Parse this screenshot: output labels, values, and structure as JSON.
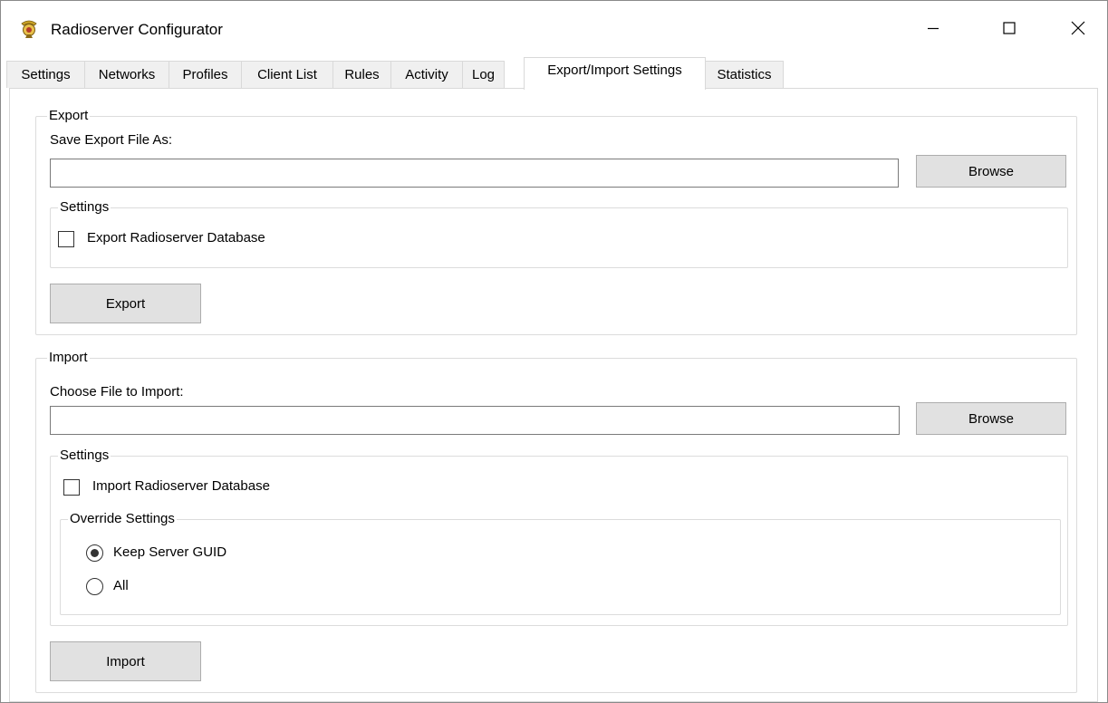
{
  "window": {
    "title": "Radioserver Configurator",
    "icon": "radio-tower-icon",
    "minimize_glyph": "—",
    "close_glyph": "✕"
  },
  "tabs": [
    {
      "label": "Settings",
      "active": false
    },
    {
      "label": "Networks",
      "active": false
    },
    {
      "label": "Profiles",
      "active": false
    },
    {
      "label": "Client List",
      "active": false
    },
    {
      "label": "Rules",
      "active": false
    },
    {
      "label": "Activity",
      "active": false
    },
    {
      "label": "Log",
      "active": false
    },
    {
      "label": "Export/Import Settings",
      "active": true
    },
    {
      "label": "Statistics",
      "active": false
    }
  ],
  "export": {
    "group_title": "Export",
    "file_label": "Save Export File As:",
    "file_value": "",
    "browse_label": "Browse",
    "settings_title": "Settings",
    "db_checkbox_label": "Export Radioserver Database",
    "db_checked": false,
    "action_label": "Export"
  },
  "import": {
    "group_title": "Import",
    "file_label": "Choose File to Import:",
    "file_value": "",
    "browse_label": "Browse",
    "settings_title": "Settings",
    "db_checkbox_label": "Import Radioserver Database",
    "db_checked": false,
    "override_title": "Override Settings",
    "override_options": [
      {
        "label": "Keep Server GUID",
        "selected": true
      },
      {
        "label": "All",
        "selected": false
      }
    ],
    "action_label": "Import"
  },
  "colors": {
    "tab_inactive_bg": "#f0f0f0",
    "button_bg": "#e1e1e1",
    "group_border": "#dcdcdc"
  }
}
